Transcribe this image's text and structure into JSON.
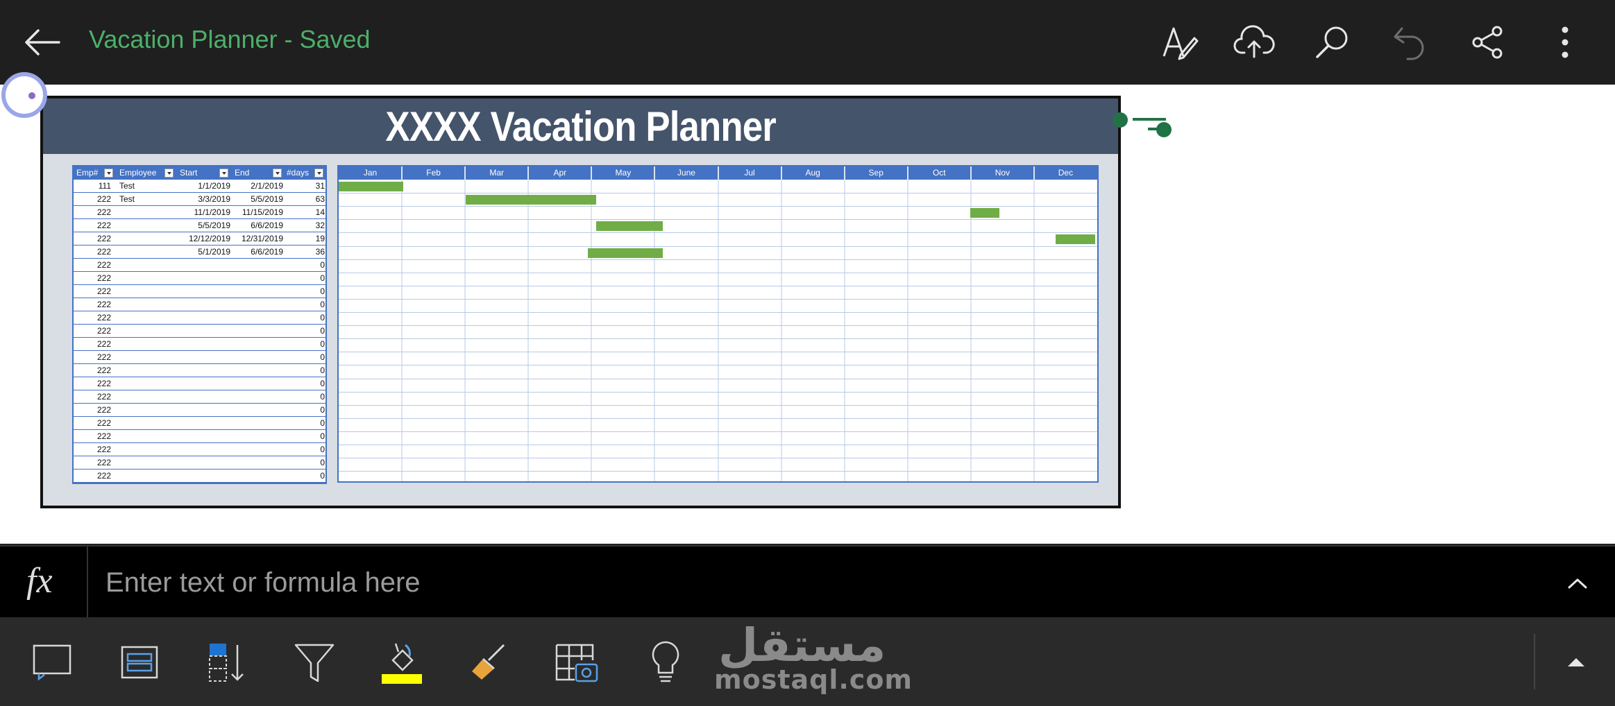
{
  "app": {
    "title": "Vacation Planner - Saved",
    "accent_color": "#4caf6a"
  },
  "toolbar": {
    "back_icon": "arrow-left-icon",
    "icons": [
      "draw-pen-icon",
      "cloud-upload-icon",
      "search-icon",
      "undo-icon",
      "share-icon",
      "more-vertical-icon"
    ]
  },
  "sheet": {
    "banner_title": "XXXX Vacation Planner",
    "table": {
      "columns": [
        "Emp#",
        "Employee",
        "Start",
        "End",
        "#days"
      ],
      "rows": [
        [
          "111",
          "Test",
          "1/1/2019",
          "2/1/2019",
          "31"
        ],
        [
          "222",
          "Test",
          "3/3/2019",
          "5/5/2019",
          "63"
        ],
        [
          "222",
          "",
          "11/1/2019",
          "11/15/2019",
          "14"
        ],
        [
          "222",
          "",
          "5/5/2019",
          "6/6/2019",
          "32"
        ],
        [
          "222",
          "",
          "12/12/2019",
          "12/31/2019",
          "19"
        ],
        [
          "222",
          "",
          "5/1/2019",
          "6/6/2019",
          "36"
        ],
        [
          "222",
          "",
          "",
          "",
          "0"
        ],
        [
          "222",
          "",
          "",
          "",
          "0"
        ],
        [
          "222",
          "",
          "",
          "",
          "0"
        ],
        [
          "222",
          "",
          "",
          "",
          "0"
        ],
        [
          "222",
          "",
          "",
          "",
          "0"
        ],
        [
          "222",
          "",
          "",
          "",
          "0"
        ],
        [
          "222",
          "",
          "",
          "",
          "0"
        ],
        [
          "222",
          "",
          "",
          "",
          "0"
        ],
        [
          "222",
          "",
          "",
          "",
          "0"
        ],
        [
          "222",
          "",
          "",
          "",
          "0"
        ],
        [
          "222",
          "",
          "",
          "",
          "0"
        ],
        [
          "222",
          "",
          "",
          "",
          "0"
        ],
        [
          "222",
          "",
          "",
          "",
          "0"
        ],
        [
          "222",
          "",
          "",
          "",
          "0"
        ],
        [
          "222",
          "",
          "",
          "",
          "0"
        ],
        [
          "222",
          "",
          "",
          "",
          "0"
        ],
        [
          "222",
          "",
          "",
          "",
          "0"
        ]
      ]
    },
    "gantt": {
      "months": [
        "Jan",
        "Feb",
        "Mar",
        "Apr",
        "May",
        "June",
        "Jul",
        "Aug",
        "Sep",
        "Oct",
        "Nov",
        "Dec"
      ],
      "bar_color": "#70ad47"
    }
  },
  "formula_bar": {
    "fx_label": "fx",
    "placeholder": "Enter text or formula here"
  },
  "bottom_toolbar": {
    "icons": [
      "select-cells-icon",
      "format-cells-icon",
      "sort-icon",
      "filter-icon",
      "fill-color-icon",
      "format-painter-icon",
      "insert-table-image-icon",
      "tell-me-lightbulb-icon"
    ],
    "fill_color": "#ffff00",
    "collapse_icon": "caret-up-icon"
  },
  "watermark": {
    "arabic": "مستقل",
    "latin": "mostaql.com"
  }
}
